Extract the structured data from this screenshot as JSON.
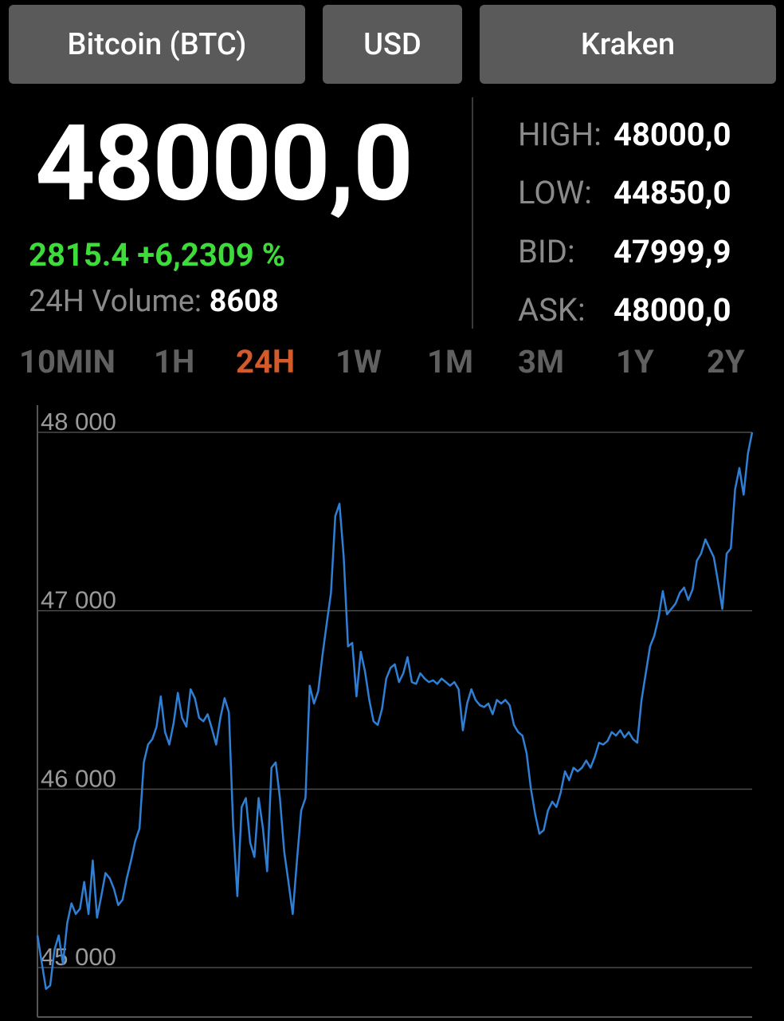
{
  "selectors": {
    "coin": "Bitcoin (BTC)",
    "currency": "USD",
    "exchange": "Kraken"
  },
  "price": "48000,0",
  "change": "2815.4 +6,2309 %",
  "volume": {
    "label": "24H Volume:",
    "value": "8608"
  },
  "stats": [
    {
      "label": "HIGH:",
      "value": "48000,0"
    },
    {
      "label": "LOW:",
      "value": "44850,0"
    },
    {
      "label": "BID:",
      "value": "47999,9"
    },
    {
      "label": "ASK:",
      "value": "48000,0"
    }
  ],
  "ranges": [
    "10MIN",
    "1H",
    "24H",
    "1W",
    "1M",
    "3M",
    "1Y",
    "2Y"
  ],
  "active_range": "24H",
  "colors": {
    "line": "#2f7fd4",
    "active_tab": "#d35a2b",
    "change": "#3ddc3a"
  },
  "chart_data": {
    "type": "line",
    "ylim": [
      44850,
      48000
    ],
    "ytick_labels": [
      "48 000",
      "47 000",
      "46 000",
      "45 000"
    ],
    "yticks": [
      48000,
      47000,
      46000,
      45000
    ],
    "y": [
      45180,
      45030,
      44880,
      44900,
      45100,
      45180,
      45020,
      45250,
      45360,
      45300,
      45330,
      45480,
      45300,
      45600,
      45280,
      45400,
      45530,
      45500,
      45440,
      45350,
      45380,
      45500,
      45600,
      45710,
      45780,
      46150,
      46250,
      46280,
      46350,
      46520,
      46320,
      46250,
      46370,
      46540,
      46400,
      46350,
      46560,
      46510,
      46400,
      46380,
      46420,
      46340,
      46250,
      46400,
      46510,
      46430,
      45800,
      45400,
      45900,
      45950,
      45700,
      45620,
      45950,
      45780,
      45540,
      46120,
      46150,
      45950,
      45650,
      45480,
      45300,
      45600,
      45880,
      45950,
      46580,
      46480,
      46550,
      46750,
      46930,
      47100,
      47530,
      47600,
      47300,
      46800,
      46820,
      46520,
      46770,
      46660,
      46500,
      46380,
      46360,
      46450,
      46620,
      46680,
      46700,
      46600,
      46650,
      46740,
      46600,
      46590,
      46650,
      46620,
      46600,
      46610,
      46590,
      46620,
      46600,
      46580,
      46600,
      46560,
      46330,
      46480,
      46560,
      46500,
      46470,
      46460,
      46480,
      46420,
      46500,
      46480,
      46500,
      46470,
      46360,
      46320,
      46300,
      46200,
      46000,
      45860,
      45750,
      45770,
      45880,
      45930,
      45900,
      45980,
      46100,
      46050,
      46120,
      46100,
      46120,
      46160,
      46120,
      46180,
      46260,
      46250,
      46270,
      46320,
      46300,
      46330,
      46290,
      46320,
      46280,
      46260,
      46500,
      46650,
      46800,
      46860,
      46960,
      47110,
      46980,
      47010,
      47040,
      47100,
      47130,
      47060,
      47120,
      47280,
      47320,
      47400,
      47350,
      47300,
      47160,
      47010,
      47320,
      47350,
      47680,
      47800,
      47650,
      47880,
      48000
    ]
  }
}
